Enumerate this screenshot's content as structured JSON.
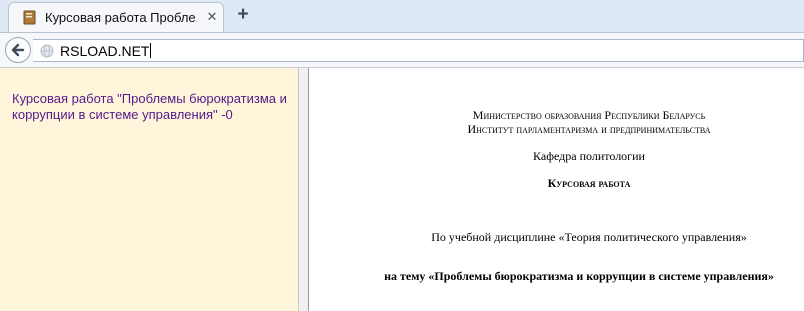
{
  "browser": {
    "tab": {
      "title": "Курсовая работа Пробле...",
      "close_glyph": "✕",
      "favicon": "document-favicon"
    },
    "new_tab_glyph": "+",
    "address_bar": {
      "url": "RSLOAD.NET",
      "icon": "globe-icon"
    },
    "back_icon": "back-arrow-icon"
  },
  "left_pane": {
    "link_text": "Курсовая работа \"Проблемы бюрократизма и коррупции в системе управления\" -0"
  },
  "document": {
    "ministry": "Министерство образования Республики Беларусь",
    "institute": "Институт парламентаризма и предпринимательства",
    "department": "Кафедра политологии",
    "work_type": "Курсовая работа",
    "discipline": "По учебной дисциплине «Теория политического управления»",
    "topic": "на тему «Проблемы бюрократизма и коррупции в системе управления»"
  },
  "colors": {
    "tabstrip": "#dfe9f6",
    "left_pane": "#fff5da",
    "link": "#551a8b"
  }
}
